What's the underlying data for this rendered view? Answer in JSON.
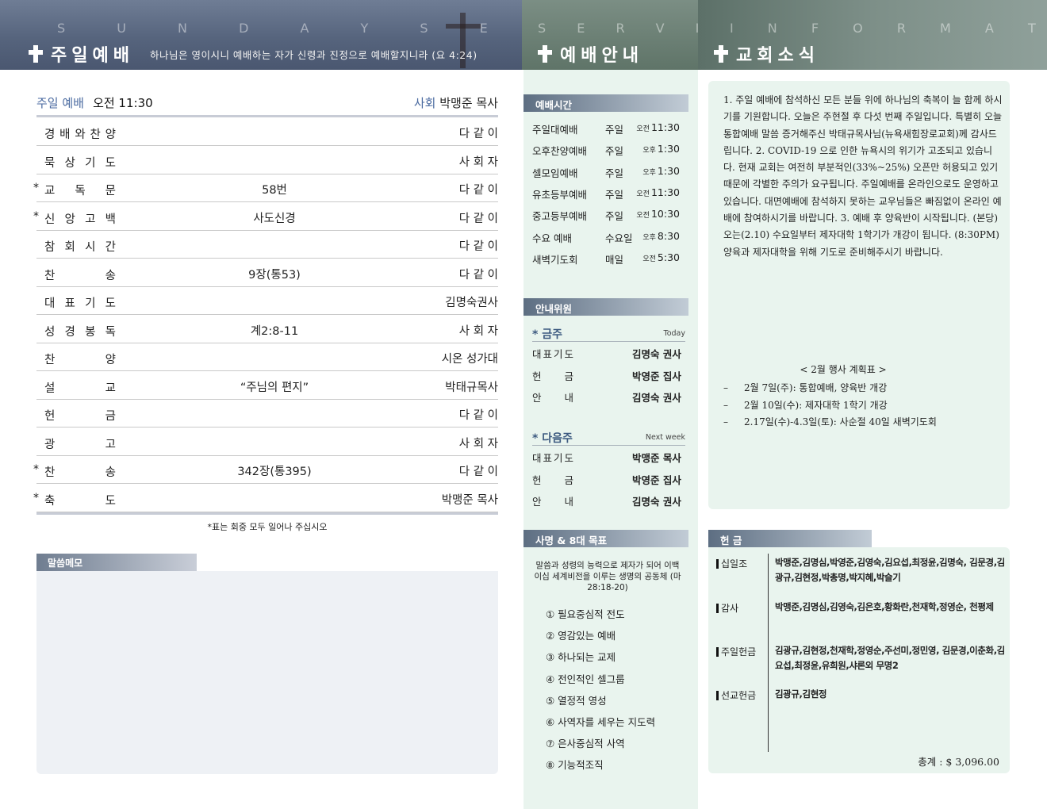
{
  "header": {
    "left_deco": "S U N D A Y     S E R V I C E",
    "left_title": "주일예배",
    "verse": "하나님은 영이시니 예배하는 자가 신령과 진정으로 예배할지니라 (요 4:24)",
    "mid_deco": "S E R V I C E",
    "mid_title": "예배안내",
    "right_deco": "I N F O R M A T I O N",
    "right_title": "교회소식"
  },
  "service": {
    "label": "주일 예배",
    "time": "오전 11:30",
    "host_label": "사회",
    "host": "박맹준 목사",
    "rows": [
      {
        "star": "",
        "chars": [
          "경",
          "배",
          "와",
          "찬",
          "양"
        ],
        "mid": "",
        "who": "다 같 이"
      },
      {
        "star": "",
        "chars": [
          "묵",
          "상",
          "기",
          "도"
        ],
        "mid": "",
        "who": "사 회 자"
      },
      {
        "star": "*",
        "chars": [
          "교",
          "독",
          "문"
        ],
        "mid": "58번",
        "who": "다 같 이"
      },
      {
        "star": "*",
        "chars": [
          "신",
          "앙",
          "고",
          "백"
        ],
        "mid": "사도신경",
        "who": "다 같 이"
      },
      {
        "star": "",
        "chars": [
          "참",
          "회",
          "시",
          "간"
        ],
        "mid": "",
        "who": "다 같 이"
      },
      {
        "star": "",
        "chars": [
          "찬",
          "송"
        ],
        "mid": "9장(통53)",
        "who": "다 같 이"
      },
      {
        "star": "",
        "chars": [
          "대",
          "표",
          "기",
          "도"
        ],
        "mid": "",
        "who": "김명숙권사"
      },
      {
        "star": "",
        "chars": [
          "성",
          "경",
          "봉",
          "독"
        ],
        "mid": "계2:8-11",
        "who": "사 회 자"
      },
      {
        "star": "",
        "chars": [
          "찬",
          "양"
        ],
        "mid": "",
        "who": "시온 성가대"
      },
      {
        "star": "",
        "chars": [
          "설",
          "교"
        ],
        "mid": "“주님의 편지”",
        "who": "박태규목사"
      },
      {
        "star": "",
        "chars": [
          "헌",
          "금"
        ],
        "mid": "",
        "who": "다 같 이"
      },
      {
        "star": "",
        "chars": [
          "광",
          "고"
        ],
        "mid": "",
        "who": "사 회 자"
      },
      {
        "star": "*",
        "chars": [
          "찬",
          "송"
        ],
        "mid": "342장(통395)",
        "who": "다 같 이"
      },
      {
        "star": "*",
        "chars": [
          "축",
          "도"
        ],
        "mid": "",
        "who": "박맹준 목사"
      }
    ],
    "note": "*표는 회중 모두 일어나 주십시오"
  },
  "memo": {
    "label": "말씀메모"
  },
  "worship_times": {
    "label": "예배시간",
    "rows": [
      {
        "name": "주일대예배",
        "day": "주일",
        "ap": "오전",
        "time": "11:30"
      },
      {
        "name": "오후찬양예배",
        "day": "주일",
        "ap": "오후",
        "time": "1:30"
      },
      {
        "name": "셀모임예배",
        "day": "주일",
        "ap": "오후",
        "time": "1:30"
      },
      {
        "name": "유초등부예배",
        "day": "주일",
        "ap": "오전",
        "time": "11:30"
      },
      {
        "name": "중고등부예배",
        "day": "주일",
        "ap": "오전",
        "time": "10:30"
      },
      {
        "name": "수요 예배",
        "day": "수요일",
        "ap": "오후",
        "time": "8:30"
      },
      {
        "name": "새벽기도회",
        "day": "매일",
        "ap": "오전",
        "time": "5:30"
      }
    ]
  },
  "ushers": {
    "label": "안내위원",
    "this_week": {
      "title": "* 금주",
      "sub": "Today",
      "rows": [
        {
          "role": [
            "대",
            "표",
            "기",
            "도"
          ],
          "person": "김명숙 권사"
        },
        {
          "role": [
            "헌",
            "금"
          ],
          "person": "박영준 집사"
        },
        {
          "role": [
            "안",
            "내"
          ],
          "person": "김영숙 권사"
        }
      ]
    },
    "next_week": {
      "title": "* 다음주",
      "sub": "Next week",
      "rows": [
        {
          "role": [
            "대",
            "표",
            "기",
            "도"
          ],
          "person": "박맹준 목사"
        },
        {
          "role": [
            "헌",
            "금"
          ],
          "person": "박영준 집사"
        },
        {
          "role": [
            "안",
            "내"
          ],
          "person": "김명숙 권사"
        }
      ]
    }
  },
  "mission": {
    "label": "사명 & 8대 목표",
    "text": "말씀과 성령의 능력으로 제자가 되어 이백 이십 세계비전을 이루는 생명의 공동체 (마 28:18-20)",
    "goals": [
      "① 필요중심적 전도",
      "② 영감있는 예배",
      "③ 하나되는 교제",
      "④ 전인적인 셀그룹",
      "⑤ 열정적 영성",
      "⑥ 사역자를 세우는 지도력",
      "⑦ 은사중심적 사역",
      "⑧ 기능적조직"
    ]
  },
  "news": {
    "text": "1. 주일 예배에 참석하신 모든 분들 위에 하나님의 축복이 늘 함께 하시기를 기원합니다. 오늘은 주현절 후 다섯 번째 주일입니다. 특별히 오늘 통합예배 말씀 증거해주신 박태규목사님(뉴욕새힘장로교회)께 감사드립니다. 2. COVID-19 으로 인한 뉴욕시의 위기가 고조되고 있습니다. 현재 교회는 여전히 부분적인(33%~25%) 오픈만 허용되고 있기 때문에 각별한 주의가 요구됩니다. 주일예배를 온라인으로도 운영하고 있습니다. 대면예배에 참석하지 못하는 교우님들은 빠짐없이 온라인 예배에 참여하시기를 바랍니다. 3. 예배 후 양육반이 시작됩니다. (본당) 오는(2.10) 수요일부터 제자대학 1학기가 개강이 됩니다. (8:30PM) 양육과 제자대학을 위해 기도로 준비해주시기 바랍니다.",
    "plan_title": "< 2월 행사 계획표 >",
    "plan": [
      "2월 7일(주): 통합예배, 양육반 개강",
      "2월 10일(수): 제자대학 1학기 개강",
      "2.17일(수)-4.3일(토): 사순절 40일 새벽기도회"
    ]
  },
  "offering": {
    "label": "헌 금",
    "categories": [
      {
        "name": "십일조",
        "names": "박맹준,김명심,박영준,김영숙,김요섭,최정윤,김명숙, 김문경,김광규,김현정,박총명,박지혜,박슬기"
      },
      {
        "name": "감사",
        "names": "박맹준,김명심,김영숙,김은호,황화란,천재학,정영순, 천평제"
      },
      {
        "name": "주일헌금",
        "names": "김광규,김현정,천재학,정영순,주선미,정민영, 김문경,이춘화,김요섭,최정윤,유희원,샤론외 무명2"
      },
      {
        "name": "선교헌금",
        "names": "김광규,김현정"
      }
    ],
    "total": "총계 : $ 3,096.00"
  }
}
